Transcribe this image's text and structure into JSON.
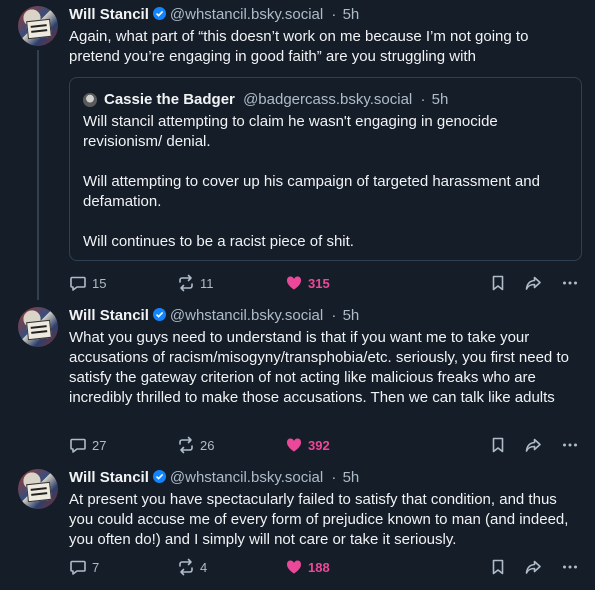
{
  "posts": [
    {
      "author": "Will Stancil",
      "handle": "@whstancil.bsky.social",
      "time": "5h",
      "text": "Again, what part of “this doesn’t work on me because I’m not going to pretend you’re engaging in good faith” are you struggling with",
      "quote": {
        "author": "Cassie the Badger",
        "handle": "@badgercass.bsky.social",
        "time": "5h",
        "paragraphs": [
          "Will stancil attempting to claim he wasn't engaging in genocide revisionism/ denial.",
          "Will attempting to cover up his campaign of targeted harassment and defamation.",
          "Will continues to be a racist piece of shit."
        ]
      },
      "replies": "15",
      "reposts": "11",
      "likes": "315"
    },
    {
      "author": "Will Stancil",
      "handle": "@whstancil.bsky.social",
      "time": "5h",
      "text": "What you guys need to understand is that if you want me to take your accusations of racism/misogyny/transphobia/etc. seriously, you first need to satisfy the gateway criterion of not acting like malicious freaks who are incredibly thrilled to make those accusations. Then we can talk like adults",
      "replies": "27",
      "reposts": "26",
      "likes": "392"
    },
    {
      "author": "Will Stancil",
      "handle": "@whstancil.bsky.social",
      "time": "5h",
      "text": "At present you have spectacularly failed to satisfy that condition, and thus you could accuse me of every form of prejudice known to man (and indeed, you often do!) and I simply will not care or take it seriously.",
      "replies": "7",
      "reposts": "4",
      "likes": "188"
    }
  ],
  "separator": "·",
  "icons": [
    "verified-badge-icon",
    "reply-icon",
    "repost-icon",
    "heart-icon",
    "bookmark-icon",
    "share-icon",
    "more-icon"
  ],
  "colors": {
    "background": "#151d28",
    "like": "#ec4899",
    "verified": "#1185fe",
    "muted": "#aebbc9"
  }
}
